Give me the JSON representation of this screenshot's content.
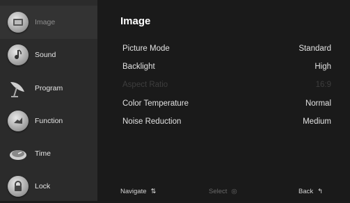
{
  "sidebar": {
    "items": [
      {
        "label": "Image",
        "icon": "image-icon",
        "active": true
      },
      {
        "label": "Sound",
        "icon": "music-note-icon",
        "active": false
      },
      {
        "label": "Program",
        "icon": "satellite-dish-icon",
        "active": false
      },
      {
        "label": "Function",
        "icon": "function-icon",
        "active": false
      },
      {
        "label": "Time",
        "icon": "clock-icon",
        "active": false
      },
      {
        "label": "Lock",
        "icon": "lock-icon",
        "active": false
      }
    ]
  },
  "main": {
    "title": "Image",
    "settings": [
      {
        "label": "Picture Mode",
        "value": "Standard",
        "disabled": false
      },
      {
        "label": "Backlight",
        "value": "High",
        "disabled": false
      },
      {
        "label": "Aspect Ratio",
        "value": "16:9",
        "disabled": true
      },
      {
        "label": "Color Temperature",
        "value": "Normal",
        "disabled": false
      },
      {
        "label": "Noise Reduction",
        "value": "Medium",
        "disabled": false
      }
    ]
  },
  "footer": {
    "navigate": "Navigate",
    "select": "Select",
    "back": "Back"
  }
}
